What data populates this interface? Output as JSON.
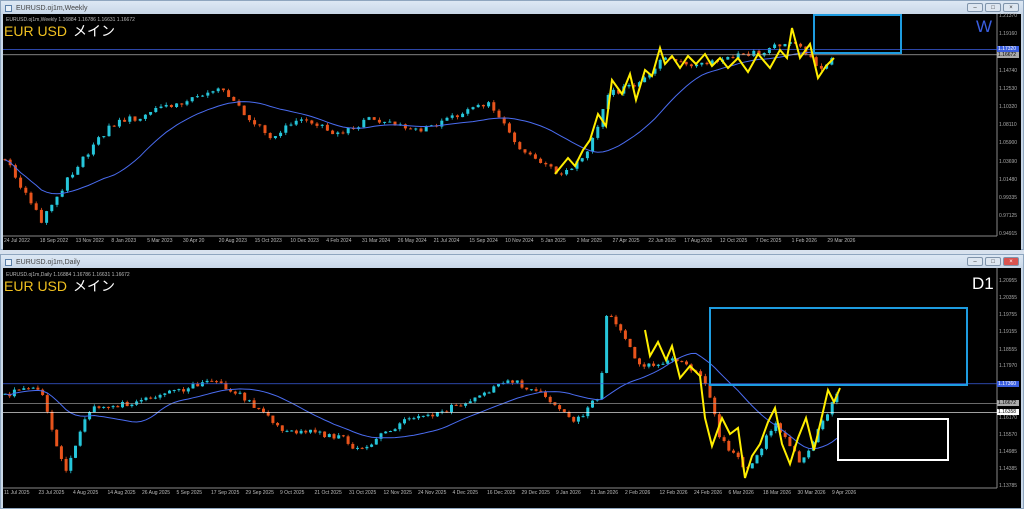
{
  "weekly": {
    "window_title": "EURUSD.oj1m,Weekly",
    "header": "EURUSD.oj1m,Weekly  1.16884 1.16786 1.16631 1.16672",
    "symbol": "EUR USD",
    "label": "メイン",
    "timeframe": "W",
    "price_labels": [
      "1.21370",
      "1.19160",
      "1.14740",
      "1.12530",
      "1.10320",
      "1.08110",
      "1.05900",
      "1.03690",
      "1.01480",
      "0.99335",
      "0.97125",
      "0.94915"
    ],
    "price_tags": [
      "1.17320",
      "1.16672"
    ],
    "date_labels": [
      "24 Jul 2022",
      "18 Sep 2022",
      "13 Nov 2022",
      "8 Jan 2023",
      "5 Mar 2023",
      "30 Apr 20",
      "20 Aug 2023",
      "15 Oct 2023",
      "10 Dec 2023",
      "4 Feb 2024",
      "31 Mar 2024",
      "26 May 2024",
      "21 Jul 2024",
      "15 Sep 2024",
      "10 Nov 2024",
      "5 Jan 2025",
      "2 Mar 2025",
      "27 Apr 2025",
      "22 Jun 2025",
      "17 Aug 2025",
      "12 Oct 2025",
      "7 Dec 2025",
      "1 Feb 2026",
      "29 Mar 2026"
    ],
    "range": [
      0.94915,
      1.2137
    ],
    "path": [
      [
        5,
        1.04
      ],
      [
        25,
        1.0
      ],
      [
        42,
        0.965
      ],
      [
        70,
        1.02
      ],
      [
        110,
        1.08
      ],
      [
        160,
        1.1
      ],
      [
        222,
        1.125
      ],
      [
        270,
        1.065
      ],
      [
        300,
        1.09
      ],
      [
        340,
        1.07
      ],
      [
        370,
        1.09
      ],
      [
        420,
        1.075
      ],
      [
        470,
        1.1
      ],
      [
        490,
        1.11
      ],
      [
        520,
        1.05
      ],
      [
        560,
        1.022
      ],
      [
        585,
        1.04
      ],
      [
        610,
        1.12
      ],
      [
        640,
        1.13
      ],
      [
        660,
        1.16
      ],
      [
        700,
        1.155
      ],
      [
        760,
        1.17
      ],
      [
        790,
        1.185
      ],
      [
        820,
        1.15
      ],
      [
        835,
        1.167
      ]
    ]
  },
  "daily": {
    "window_title": "EURUSD.oj1m,Daily",
    "header": "EURUSD.oj1m,Daily  1.16884 1.16786 1.16631 1.16672",
    "symbol": "EUR USD",
    "label": "メイン",
    "timeframe": "D1",
    "price_labels": [
      "1.20955",
      "1.20355",
      "1.19755",
      "1.19155",
      "1.18555",
      "1.17970",
      "1.16170",
      "1.15570",
      "1.14985",
      "1.14385",
      "1.13785"
    ],
    "price_tags": [
      "1.17360",
      "1.16672",
      "1.16358"
    ],
    "date_labels": [
      "11 Jul 2025",
      "23 Jul 2025",
      "4 Aug 2025",
      "14 Aug 2025",
      "26 Aug 2025",
      "5 Sep 2025",
      "17 Sep 2025",
      "29 Sep 2025",
      "9 Oct 2025",
      "21 Oct 2025",
      "31 Oct 2025",
      "12 Nov 2025",
      "24 Nov 2025",
      "4 Dec 2025",
      "16 Dec 2025",
      "29 Dec 2025",
      "9 Jan 2026",
      "21 Jan 2026",
      "2 Feb 2026",
      "12 Feb 2026",
      "24 Feb 2026",
      "6 Mar 2026",
      "18 Mar 2026",
      "30 Mar 2026",
      "9 Apr 2026"
    ],
    "range": [
      1.13785,
      1.20955
    ],
    "path": [
      [
        5,
        1.17
      ],
      [
        40,
        1.172
      ],
      [
        65,
        1.142
      ],
      [
        90,
        1.165
      ],
      [
        150,
        1.168
      ],
      [
        210,
        1.175
      ],
      [
        240,
        1.17
      ],
      [
        280,
        1.158
      ],
      [
        340,
        1.155
      ],
      [
        360,
        1.15
      ],
      [
        400,
        1.16
      ],
      [
        450,
        1.165
      ],
      [
        510,
        1.175
      ],
      [
        540,
        1.17
      ],
      [
        575,
        1.16
      ],
      [
        600,
        1.17
      ],
      [
        607,
        1.2
      ],
      [
        640,
        1.18
      ],
      [
        680,
        1.182
      ],
      [
        705,
        1.175
      ],
      [
        720,
        1.155
      ],
      [
        748,
        1.143
      ],
      [
        775,
        1.16
      ],
      [
        800,
        1.146
      ],
      [
        820,
        1.158
      ],
      [
        840,
        1.172
      ]
    ]
  },
  "colors": {
    "bull": "#26c6da",
    "bear": "#e8541c",
    "ma": "#4a6cf0",
    "zigzag": "#ffee00",
    "box_blue": "#1e9ce0",
    "box_white": "#ffffff"
  }
}
